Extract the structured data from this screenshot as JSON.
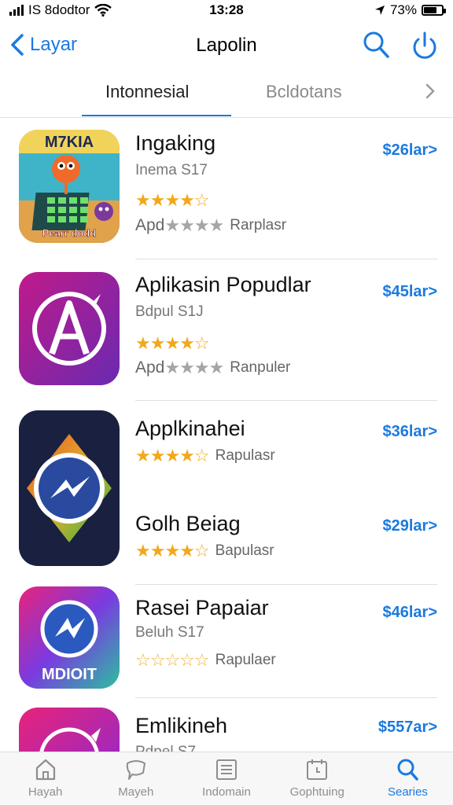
{
  "status": {
    "carrier": "IS 8dodtor",
    "time": "13:28",
    "battery": "73%",
    "battery_level": 0.73
  },
  "nav": {
    "back_label": "Layar",
    "title": "Lapolin"
  },
  "segments": {
    "active": "Intonnesial",
    "inactive": "Bcldotans"
  },
  "apps": [
    {
      "name": "Ingaking",
      "sub": "Inema S17",
      "price": "$26lar>",
      "rating_stars": "★★★★☆",
      "dev_prefix": "Apd",
      "dev_stars": "★★★★",
      "dev_label": "Rarplasr",
      "icon_text_top": "M7KIA",
      "icon_text_bottom": "Pearr dodd"
    },
    {
      "name": "Aplikasin Popudlar",
      "sub": "Bdpul S1J",
      "price": "$45lar>",
      "rating_stars": "★★★★☆",
      "dev_prefix": "Apd",
      "dev_stars": "★★★★",
      "dev_label": "Ranpuler"
    },
    {
      "name": "Applkinahei",
      "price": "$36lar>",
      "rating_stars": "★★★★☆",
      "dev_label": "Rapulasr"
    },
    {
      "name": "Golh Beiag",
      "price": "$29lar>",
      "rating_stars": "★★★★☆",
      "dev_label": "Bapulasr"
    },
    {
      "name": "Rasei Papaiar",
      "sub": "Beluh S17",
      "price": "$46lar>",
      "rating_stars": "☆☆☆☆☆",
      "dev_label": "Rapulaer",
      "icon_text_bottom": "MDIOIT"
    },
    {
      "name": "Emlikineh",
      "sub": "Pdpel S7",
      "price": "$557ar>"
    }
  ],
  "tabs": [
    {
      "label": "Hayah",
      "icon": "home-icon"
    },
    {
      "label": "Mayeh",
      "icon": "speech-bubble-icon"
    },
    {
      "label": "Indomain",
      "icon": "list-icon"
    },
    {
      "label": "Gophtuing",
      "icon": "calendar-icon"
    },
    {
      "label": "Searies",
      "icon": "search-icon"
    }
  ],
  "colors": {
    "accent": "#1a7ae0",
    "star": "#f2a81a"
  }
}
